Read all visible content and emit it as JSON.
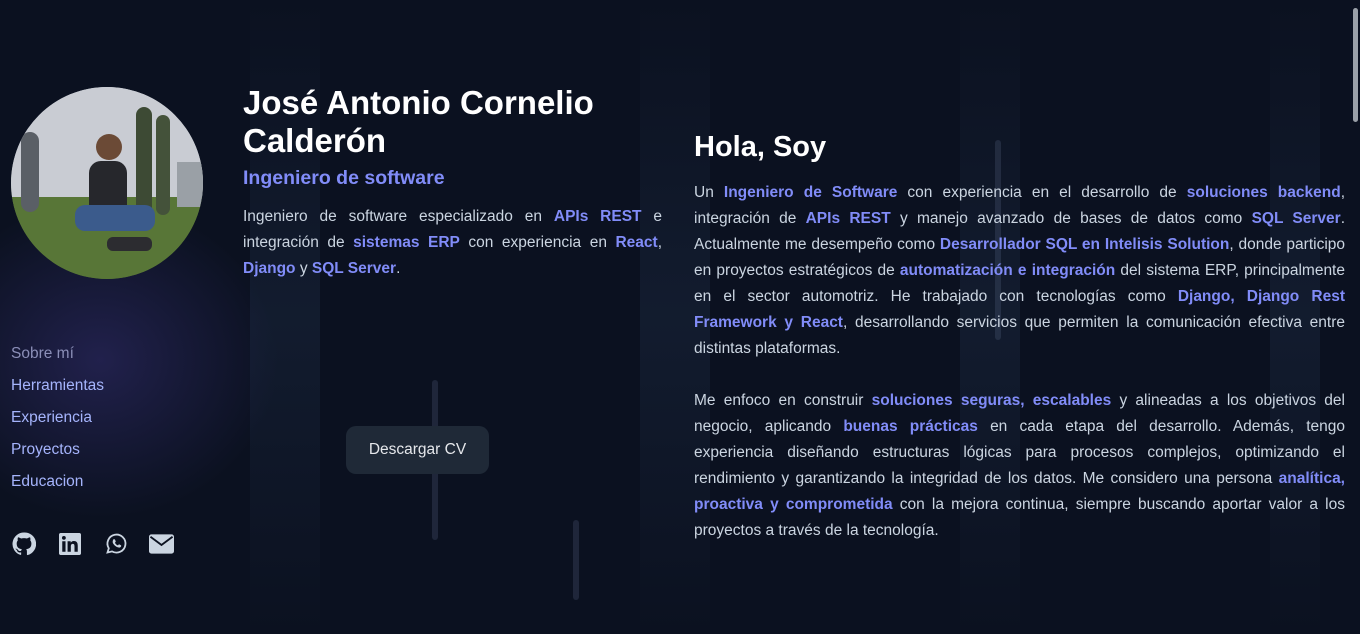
{
  "profile": {
    "name": "José Antonio Cornelio Calderón",
    "role": "Ingeniero de software",
    "summary": [
      {
        "t": "Ingeniero de software especializado en "
      },
      {
        "t": "APIs REST",
        "hl": true
      },
      {
        "t": " e integración de "
      },
      {
        "t": "sistemas ERP",
        "hl": true
      },
      {
        "t": " con experiencia en "
      },
      {
        "t": "React",
        "hl": true
      },
      {
        "t": ", "
      },
      {
        "t": "Django",
        "hl": true
      },
      {
        "t": " y "
      },
      {
        "t": "SQL Server",
        "hl": true
      },
      {
        "t": "."
      }
    ]
  },
  "nav": {
    "items": [
      {
        "label": "Sobre mí",
        "active": true
      },
      {
        "label": "Herramientas"
      },
      {
        "label": "Experiencia"
      },
      {
        "label": "Proyectos"
      },
      {
        "label": "Educacion"
      }
    ]
  },
  "socials": [
    "github-icon",
    "linkedin-icon",
    "whatsapp-icon",
    "email-icon"
  ],
  "cv_button": {
    "label": "Descargar CV"
  },
  "about": {
    "heading": "Hola, Soy",
    "paragraphs": [
      [
        {
          "t": "Un "
        },
        {
          "t": "Ingeniero de Software",
          "hl": true
        },
        {
          "t": " con experiencia en el desarrollo de "
        },
        {
          "t": "soluciones backend",
          "hl": true
        },
        {
          "t": ", integración de "
        },
        {
          "t": "APIs REST",
          "hl": true
        },
        {
          "t": " y manejo avanzado de bases de datos como "
        },
        {
          "t": "SQL Server",
          "hl": true
        },
        {
          "t": ". Actualmente me desempeño como "
        },
        {
          "t": "Desarrollador SQL en Intelisis Solution",
          "hl": true
        },
        {
          "t": ", donde participo en proyectos estratégicos de "
        },
        {
          "t": "automatización e integración",
          "hl": true
        },
        {
          "t": " del sistema ERP, principalmente en el sector automotriz. He trabajado con tecnologías como "
        },
        {
          "t": "Django, Django Rest Framework y React",
          "hl": true
        },
        {
          "t": ", desarrollando servicios que permiten la comunicación efectiva entre distintas plataformas."
        }
      ],
      [
        {
          "t": "Me enfoco en construir "
        },
        {
          "t": "soluciones seguras, escalables",
          "hl": true
        },
        {
          "t": " y alineadas a los objetivos del negocio, aplicando "
        },
        {
          "t": "buenas prácticas",
          "hl": true
        },
        {
          "t": " en cada etapa del desarrollo. Además, tengo experiencia diseñando estructuras lógicas para procesos complejos, optimizando el rendimiento y garantizando la integridad de los datos. Me considero una persona "
        },
        {
          "t": "analítica, proactiva y comprometida",
          "hl": true
        },
        {
          "t": " con la mejora continua, siempre buscando aportar valor a los proyectos a través de la tecnología."
        }
      ]
    ]
  },
  "colors": {
    "accent": "#818cf8",
    "background": "#0b1120",
    "button": "#1f2937"
  }
}
